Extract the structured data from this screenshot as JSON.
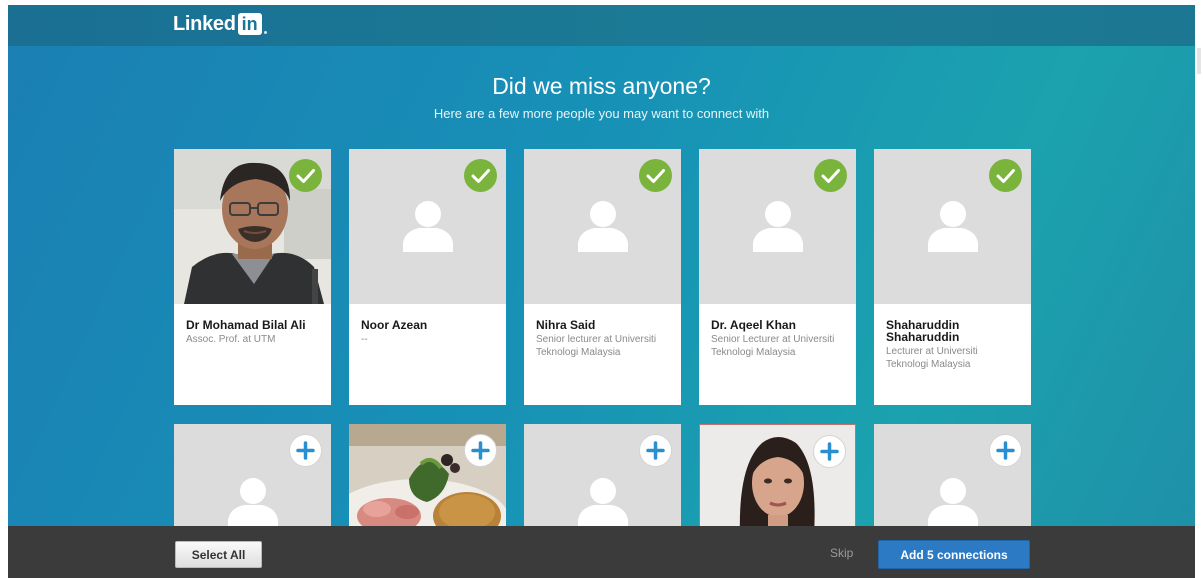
{
  "header": {
    "logo_word": "Linked",
    "logo_in": "in"
  },
  "main": {
    "title": "Did we miss anyone?",
    "subtitle": "Here are a few more people you may want to connect with"
  },
  "suggestions": [
    {
      "name": "Dr Mohamad Bilal Ali",
      "headline": "Assoc. Prof. at UTM",
      "selected": true,
      "photo": "portrait-man-glasses"
    },
    {
      "name": "Noor Azean",
      "headline": "--",
      "selected": true,
      "photo": "default-avatar"
    },
    {
      "name": "Nihra Said",
      "headline": "Senior lecturer at Universiti Teknologi Malaysia",
      "selected": true,
      "photo": "default-avatar"
    },
    {
      "name": "Dr. Aqeel Khan",
      "headline": "Senior Lecturer at Universiti Teknologi Malaysia",
      "selected": true,
      "photo": "default-avatar"
    },
    {
      "name": "Shaharuddin Shaharuddin",
      "headline": "Lecturer at Universiti Teknologi Malaysia",
      "selected": true,
      "photo": "default-avatar"
    },
    {
      "selected": false,
      "photo": "default-avatar"
    },
    {
      "selected": false,
      "photo": "food-plate"
    },
    {
      "selected": false,
      "photo": "default-avatar"
    },
    {
      "selected": false,
      "photo": "portrait-woman"
    },
    {
      "selected": false,
      "photo": "default-avatar"
    }
  ],
  "footer": {
    "select_all_label": "Select All",
    "skip_label": "Skip",
    "add_label": "Add 5 connections"
  },
  "colors": {
    "background_start": "#1b7fb4",
    "background_end": "#1ba2ae",
    "check_green": "#7ab43d",
    "plus_blue": "#2a8fcf",
    "primary_button": "#2b7ac3",
    "footer_bar": "#3b3b3b"
  },
  "icons": {
    "selected_badge": "check-circle-icon",
    "add_badge": "plus-circle-icon",
    "default_avatar": "person-silhouette-icon"
  }
}
